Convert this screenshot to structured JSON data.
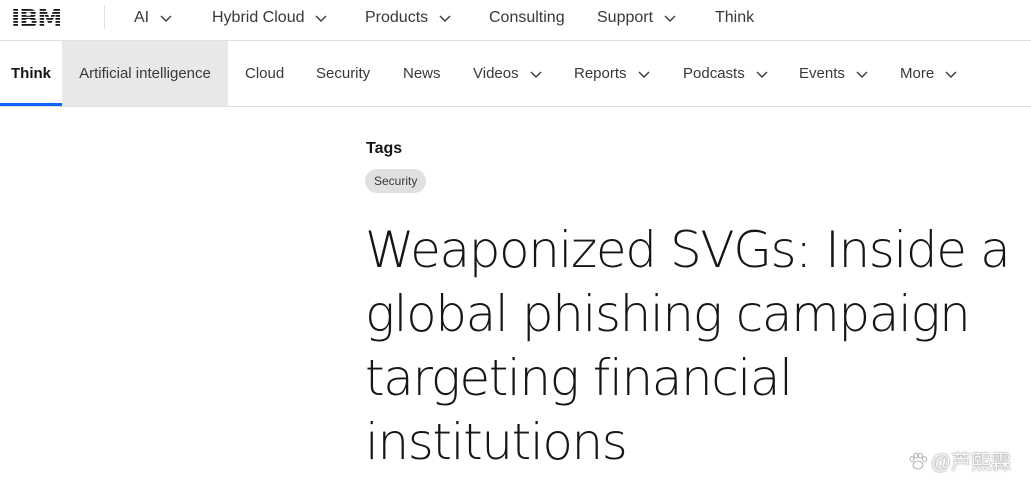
{
  "masthead": {
    "logo_text": "IBM",
    "items": [
      {
        "label": "AI",
        "has_menu": true
      },
      {
        "label": "Hybrid Cloud",
        "has_menu": true
      },
      {
        "label": "Products",
        "has_menu": true
      },
      {
        "label": "Consulting",
        "has_menu": false
      },
      {
        "label": "Support",
        "has_menu": true
      },
      {
        "label": "Think",
        "has_menu": false
      }
    ]
  },
  "subnav": {
    "items": [
      {
        "label": "Think",
        "state": "active"
      },
      {
        "label": "Artificial intelligence",
        "state": "hovered"
      },
      {
        "label": "Cloud",
        "state": "normal"
      },
      {
        "label": "Security",
        "state": "normal"
      },
      {
        "label": "News",
        "state": "normal"
      },
      {
        "label": "Videos",
        "state": "normal",
        "has_menu": true
      },
      {
        "label": "Reports",
        "state": "normal",
        "has_menu": true
      },
      {
        "label": "Podcasts",
        "state": "normal",
        "has_menu": true
      },
      {
        "label": "Events",
        "state": "normal",
        "has_menu": true
      },
      {
        "label": "More",
        "state": "normal",
        "has_menu": true
      }
    ]
  },
  "article": {
    "tags_heading": "Tags",
    "tags": [
      "Security"
    ],
    "title": "Weaponized SVGs: Inside a global phishing campaign targeting financial institutions"
  },
  "watermark": {
    "text": "@芦熙霖",
    "icon": "paw-icon"
  },
  "colors": {
    "active_underline": "#0f62fe",
    "hover_background": "#e8e8e8",
    "tag_chip_background": "#e0e0e0",
    "text_primary": "#161616",
    "text_secondary": "#393939",
    "divider": "#e0e0e0"
  }
}
